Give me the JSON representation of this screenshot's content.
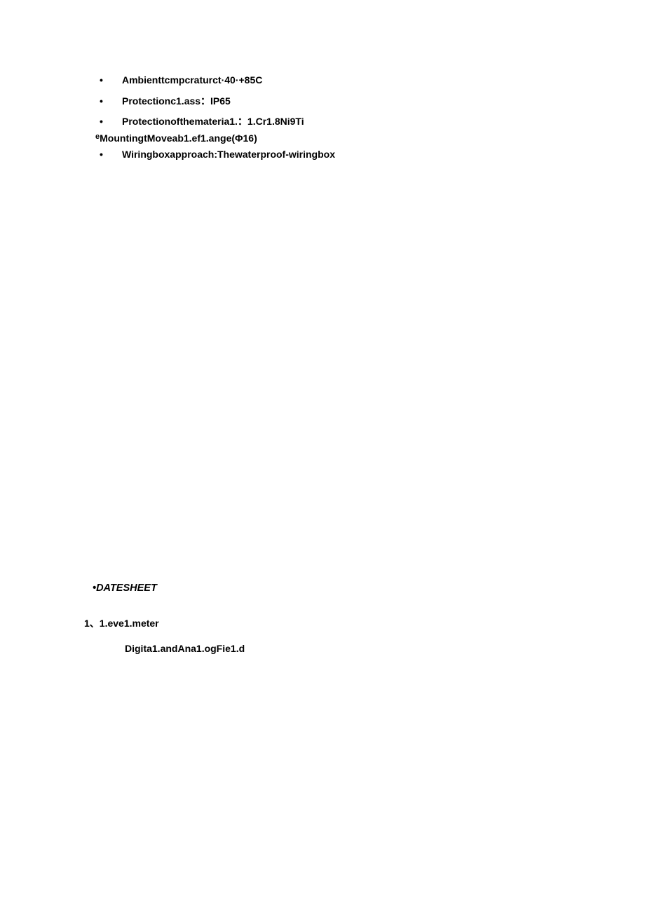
{
  "specs": {
    "items": [
      {
        "text": "Ambienttcmpcraturct·40·+85C"
      },
      {
        "text": "Protectionc1.ass：IP65"
      },
      {
        "text": "Protectionofthemateria1.：1.Cr1.8Ni9Ti"
      }
    ],
    "mountingPrefix": "e",
    "mounting": "MountingtMoveab1.ef1.ange(Φ16)",
    "wiring": "Wiringboxapproach:Thewaterproof-wiringbox"
  },
  "sections": {
    "datasheet": "•DATESHEET",
    "levelMeter": "1、1.eve1.meter",
    "digital": "Digita1.andAna1.ogFie1.d"
  }
}
